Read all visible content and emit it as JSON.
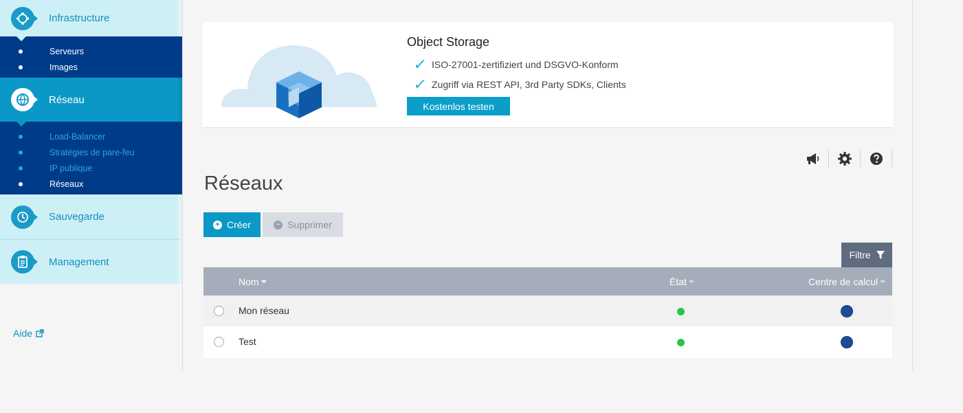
{
  "sidebar": {
    "sections": [
      {
        "label": "Infrastructure",
        "icon": "infrastructure-icon",
        "items": [
          {
            "label": "Serveurs"
          },
          {
            "label": "Images"
          }
        ]
      },
      {
        "label": "Réseau",
        "icon": "network-globe-icon",
        "items": [
          {
            "label": "Load-Balancer"
          },
          {
            "label": "Stratégies de pare-feu"
          },
          {
            "label": "IP publique"
          },
          {
            "label": "Réseaux"
          }
        ]
      },
      {
        "label": "Sauvegarde",
        "icon": "backup-clock-icon"
      },
      {
        "label": "Management",
        "icon": "clipboard-icon"
      }
    ],
    "help_label": "Aide"
  },
  "promo": {
    "title": "Object Storage",
    "features": [
      "ISO-27001-zertifiziert und DSGVO-Konform",
      "Zugriff via REST API, 3rd Party SDKs, Clients"
    ],
    "cta": "Kostenlos testen"
  },
  "page": {
    "title": "Réseaux",
    "create_label": "Créer",
    "delete_label": "Supprimer",
    "filter_label": "Filtre"
  },
  "table": {
    "columns": [
      "Nom",
      "État",
      "Centre de calcul"
    ],
    "rows": [
      {
        "name": "Mon réseau",
        "state": "active",
        "datacenter": "eu-flag-icon"
      },
      {
        "name": "Test",
        "state": "active",
        "datacenter": "eu-flag-icon"
      }
    ]
  },
  "colors": {
    "accent": "#0a99c6",
    "nav_dark": "#003b8a",
    "status_ok": "#2ac352"
  }
}
